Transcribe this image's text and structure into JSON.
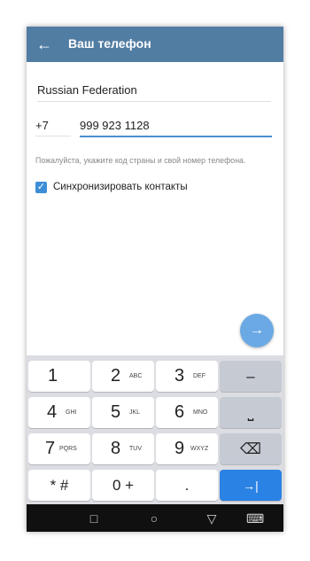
{
  "header": {
    "title": "Ваш телефон",
    "back_icon": "arrow-left-icon"
  },
  "form": {
    "country": "Russian Federation",
    "country_code": "+7",
    "phone_number": "999 923 1128",
    "hint": "Пожалуйста, укажите код страны и свой номер телефона.",
    "sync_contacts_label": "Синхронизировать контакты",
    "sync_contacts_checked": true
  },
  "fab_icon": "arrow-right-icon",
  "keyboard": {
    "keys": [
      {
        "num": "1",
        "letters": ""
      },
      {
        "num": "2",
        "letters": "ABC"
      },
      {
        "num": "3",
        "letters": "DEF"
      },
      {
        "sym": "–"
      },
      {
        "num": "4",
        "letters": "GHI"
      },
      {
        "num": "5",
        "letters": "JKL"
      },
      {
        "num": "6",
        "letters": "MNO"
      },
      {
        "sym": "⎵"
      },
      {
        "num": "7",
        "letters": "PQRS"
      },
      {
        "num": "8",
        "letters": "TUV"
      },
      {
        "num": "9",
        "letters": "WXYZ"
      },
      {
        "sym": "⌫"
      },
      {
        "sym": "* #"
      },
      {
        "sym": "0 +"
      },
      {
        "sym": "."
      },
      {
        "sym": "→|"
      }
    ]
  },
  "navbar": {
    "icons": [
      "square-icon",
      "circle-icon",
      "triangle-icon",
      "keyboard-icon"
    ]
  },
  "colors": {
    "appbar": "#527DA3",
    "accent": "#4b8ed1",
    "fab": "#6aa9e4",
    "enter_key": "#2a82e4"
  }
}
